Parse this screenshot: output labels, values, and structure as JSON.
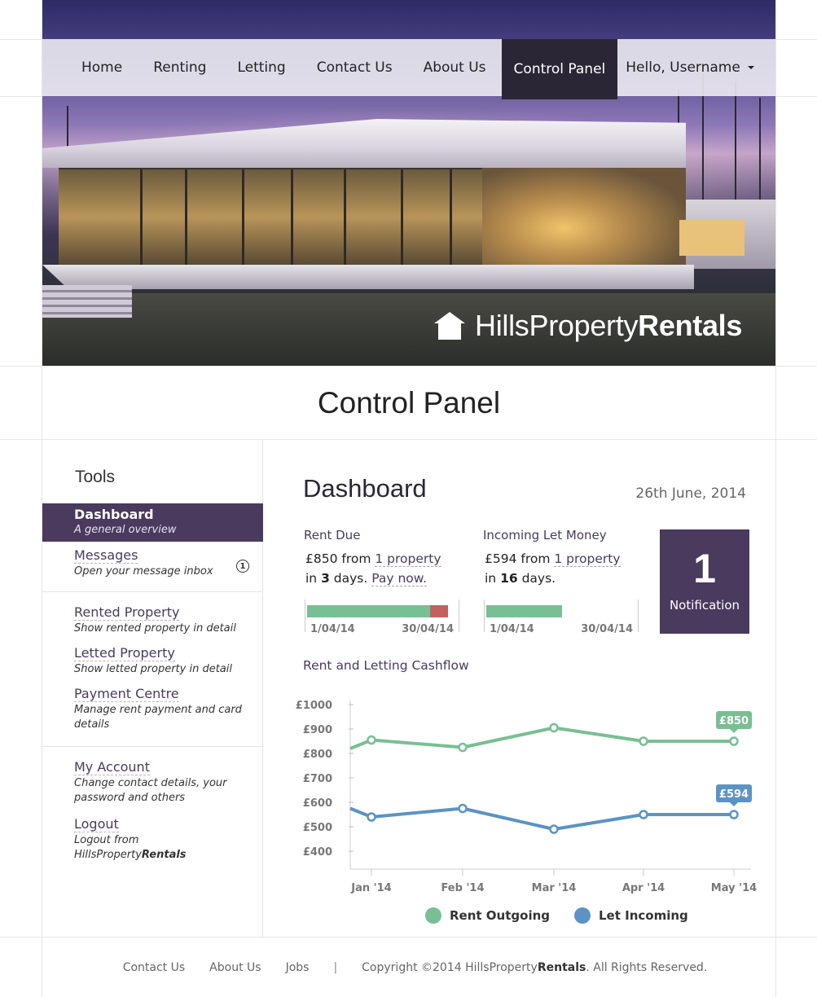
{
  "nav": {
    "items": [
      "Home",
      "Renting",
      "Letting",
      "Contact Us",
      "About Us",
      "Control Panel"
    ],
    "active": "Control Panel",
    "user_label": "Hello, Username"
  },
  "brand": {
    "light": "HillsProperty",
    "bold": "Rentals"
  },
  "page_title": "Control Panel",
  "sidebar": {
    "title": "Tools",
    "items": [
      {
        "label": "Dashboard",
        "desc": "A general overview",
        "active": true
      },
      {
        "label": "Messages",
        "desc": "Open your message inbox",
        "badge": "1"
      },
      {
        "label": "Rented Property",
        "desc": "Show rented property in detail"
      },
      {
        "label": "Letted Property",
        "desc": "Show letted property in detail"
      },
      {
        "label": "Payment Centre",
        "desc": "Manage rent payment and card details"
      },
      {
        "label": "My Account",
        "desc": "Change contact details, your password and others"
      },
      {
        "label": "Logout",
        "desc_light": "Logout from HillsProperty",
        "desc_bold": "Rentals"
      }
    ]
  },
  "dashboard": {
    "title": "Dashboard",
    "date": "26th June, 2014",
    "rent_due": {
      "title": "Rent Due",
      "amount": "£850 from ",
      "link": "1 property",
      "in": "in ",
      "days": "3",
      "days_suffix": " days. ",
      "pay_now": "Pay now.",
      "start": "1/04/14",
      "end": "30/04/14",
      "progress_paid": 0.87,
      "progress_overdue": 0.13
    },
    "incoming": {
      "title": "Incoming Let Money",
      "amount": "£594 from ",
      "link": "1 property",
      "in": "in ",
      "days": "16",
      "days_suffix": " days.",
      "start": "1/04/14",
      "end": "30/04/14",
      "progress": 0.49
    },
    "notification": {
      "count": "1",
      "label": "Notification"
    },
    "cashflow_title": "Rent and Letting Cashflow"
  },
  "chart_data": {
    "type": "line",
    "title": "Rent and Letting Cashflow",
    "categories": [
      "Jan '14",
      "Feb '14",
      "Mar '14",
      "Apr '14",
      "May '14"
    ],
    "yticks": [
      "£1000",
      "£900",
      "£800",
      "£700",
      "£600",
      "£500",
      "£400"
    ],
    "ylim": [
      400,
      1000
    ],
    "series": [
      {
        "name": "Rent Outgoing",
        "color": "#79bf94",
        "lead_in": 820,
        "values": [
          855,
          825,
          905,
          850,
          850
        ],
        "end_label": "£850"
      },
      {
        "name": "Let Incoming",
        "color": "#5c93c4",
        "lead_in": 575,
        "values": [
          540,
          575,
          490,
          550,
          550
        ],
        "end_label": "£594"
      }
    ],
    "legend": "bottom-center"
  },
  "footer": {
    "links": [
      "Contact Us",
      "About Us",
      "Jobs"
    ],
    "separator": "|",
    "copyright_prefix": "Copyright ©2014 HillsProperty",
    "copyright_bold": "Rentals",
    "copyright_suffix": ". All Rights Reserved."
  }
}
